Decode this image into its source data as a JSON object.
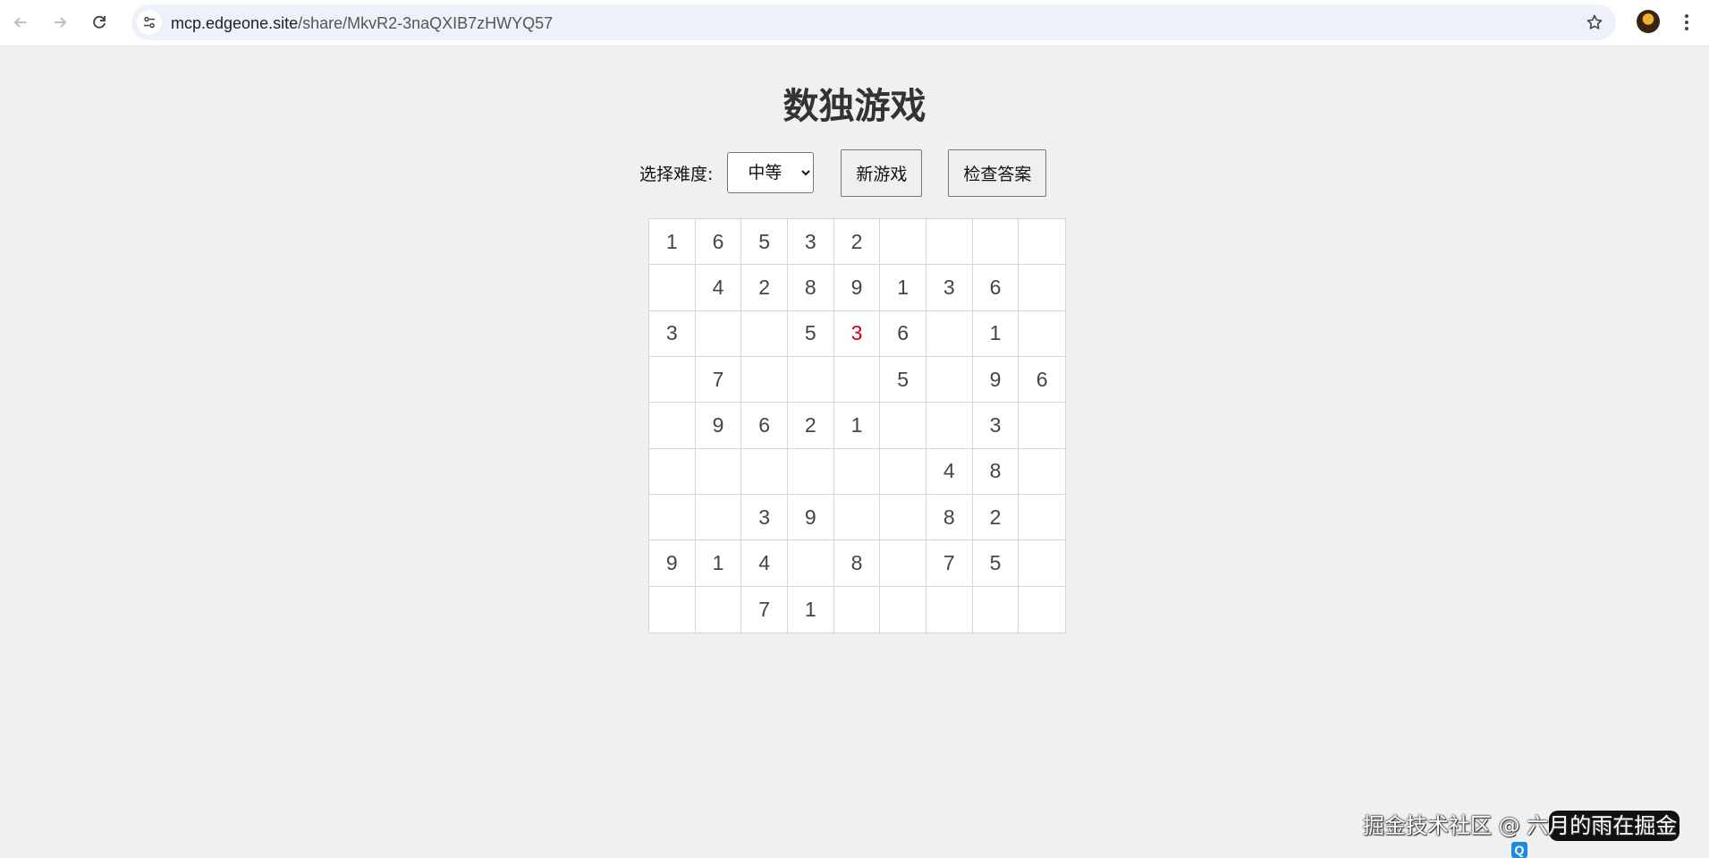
{
  "browser": {
    "url_host": "mcp.edgeone.site",
    "url_path": "/share/MkvR2-3naQXIB7zHWYQ57"
  },
  "page": {
    "title": "数独游戏",
    "difficulty_label": "选择难度:",
    "difficulty_selected": "中等",
    "new_game_label": "新游戏",
    "check_label": "检查答案"
  },
  "board": {
    "rows": [
      [
        "1",
        "6",
        "5",
        "3",
        "2",
        "",
        "",
        "",
        ""
      ],
      [
        "",
        "4",
        "2",
        "8",
        "9",
        "1",
        "3",
        "6",
        ""
      ],
      [
        "3",
        "",
        "",
        "5",
        "3",
        "6",
        "",
        "1",
        ""
      ],
      [
        "",
        "7",
        "",
        "",
        "",
        "5",
        "",
        "9",
        "6"
      ],
      [
        "",
        "9",
        "6",
        "2",
        "1",
        "",
        "",
        "3",
        ""
      ],
      [
        "",
        "",
        "",
        "",
        "",
        "",
        "4",
        "8",
        ""
      ],
      [
        "",
        "",
        "3",
        "9",
        "",
        "",
        "8",
        "2",
        ""
      ],
      [
        "9",
        "1",
        "4",
        "",
        "8",
        "",
        "7",
        "5",
        ""
      ],
      [
        "",
        "",
        "7",
        "1",
        "",
        "",
        "",
        "",
        ""
      ]
    ],
    "user_entries": [
      [
        2,
        4
      ]
    ],
    "user_entry_color": "#d0021b"
  },
  "watermark": {
    "text": "掘金技术社区 @ 六月的雨在掘金"
  },
  "icons": {
    "back": "arrow-left-icon",
    "forward": "arrow-right-icon",
    "reload": "reload-icon",
    "site_info": "tune-icon",
    "bookmark": "star-icon",
    "menu": "more-vert-icon"
  }
}
